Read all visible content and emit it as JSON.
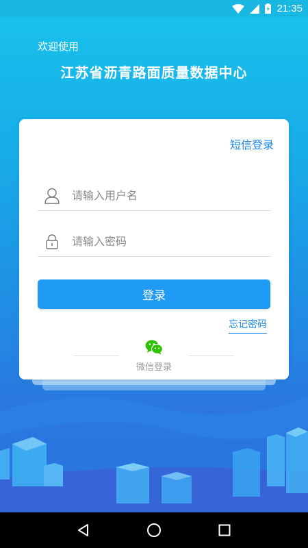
{
  "status_bar": {
    "time": "21:35",
    "icons": [
      "wifi-icon",
      "signal-icon",
      "battery-icon"
    ]
  },
  "header": {
    "welcome": "欢迎使用",
    "title": "江苏省沥青路面质量数据中心"
  },
  "login_card": {
    "sms_login_label": "短信登录",
    "username_placeholder": "请输入用户名",
    "password_placeholder": "请输入密码",
    "username_icon": "user-icon",
    "password_icon": "lock-icon",
    "login_button_label": "登录",
    "forgot_password_label": "忘记密码",
    "wechat_login_label": "微信登录",
    "wechat_icon": "wechat-icon"
  },
  "nav_bar": {
    "buttons": [
      "back-icon",
      "home-icon",
      "recents-icon"
    ]
  },
  "colors": {
    "accent": "#1f9bf6",
    "link": "#1a86e6",
    "wechat": "#2dc100"
  }
}
